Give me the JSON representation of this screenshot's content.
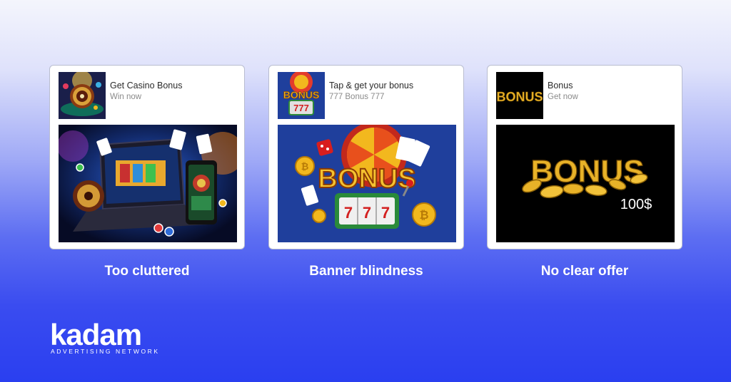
{
  "ads": [
    {
      "title": "Get Casino Bonus",
      "subtitle": "Win now",
      "caption": "Too cluttered",
      "thumb_icon": "roulette-wheel-icon",
      "banner_icon": "casino-devices-illustration"
    },
    {
      "title": "Tap & get your bonus",
      "subtitle": "777 Bonus 777",
      "caption": "Banner blindness",
      "thumb_icon": "bonus-slot-icon",
      "thumb_text": "BONUS",
      "banner_icon": "bonus-slot-machine-illustration",
      "banner_text": "BONUS",
      "reel_values": [
        "7",
        "7",
        "7"
      ]
    },
    {
      "title": "Bonus",
      "subtitle": "Get now",
      "caption": "No clear offer",
      "thumb_icon": "bonus-gold-text-icon",
      "thumb_text": "BONUS",
      "banner_icon": "bonus-gold-coins-illustration",
      "banner_text": "BONUS",
      "banner_amount": "100$"
    }
  ],
  "brand": {
    "name": "kadam",
    "tagline": "ADVERTISING NETWORK"
  },
  "colors": {
    "background_top": "#f4f5fc",
    "background_bottom": "#2a3ff0",
    "card": "#ffffff",
    "gold": "#f2b81e",
    "banner_blue": "#1f3f9c"
  }
}
